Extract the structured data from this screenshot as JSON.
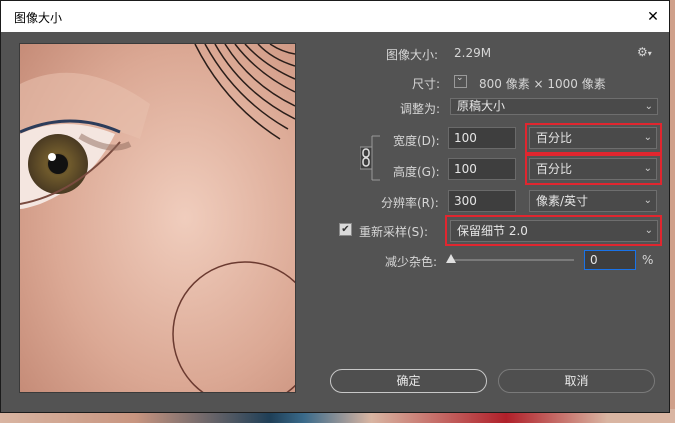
{
  "window": {
    "title": "图像大小",
    "close_glyph": "✕"
  },
  "info": {
    "size_label": "图像大小:",
    "size_value": "2.29M",
    "dimensions_label": "尺寸:",
    "dimensions_value": "800 像素 × 1000 像素",
    "fit_label": "调整为:",
    "fit_value": "原稿大小"
  },
  "fields": {
    "width_label": "宽度(D):",
    "width_value": "100",
    "width_unit": "百分比",
    "height_label": "高度(G):",
    "height_value": "100",
    "height_unit": "百分比",
    "resolution_label": "分辨率(R):",
    "resolution_value": "300",
    "resolution_unit": "像素/英寸",
    "resample_label": "重新采样(S):",
    "resample_value": "保留细节 2.0",
    "resample_checked": true,
    "noise_label": "减少杂色:",
    "noise_value": "0",
    "noise_unit": "%",
    "noise_level_fraction": 0.0
  },
  "buttons": {
    "ok": "确定",
    "cancel": "取消"
  },
  "colors": {
    "highlight": "#e1262f",
    "dialog_bg": "#535353",
    "accent_input": "#1a73e8"
  }
}
